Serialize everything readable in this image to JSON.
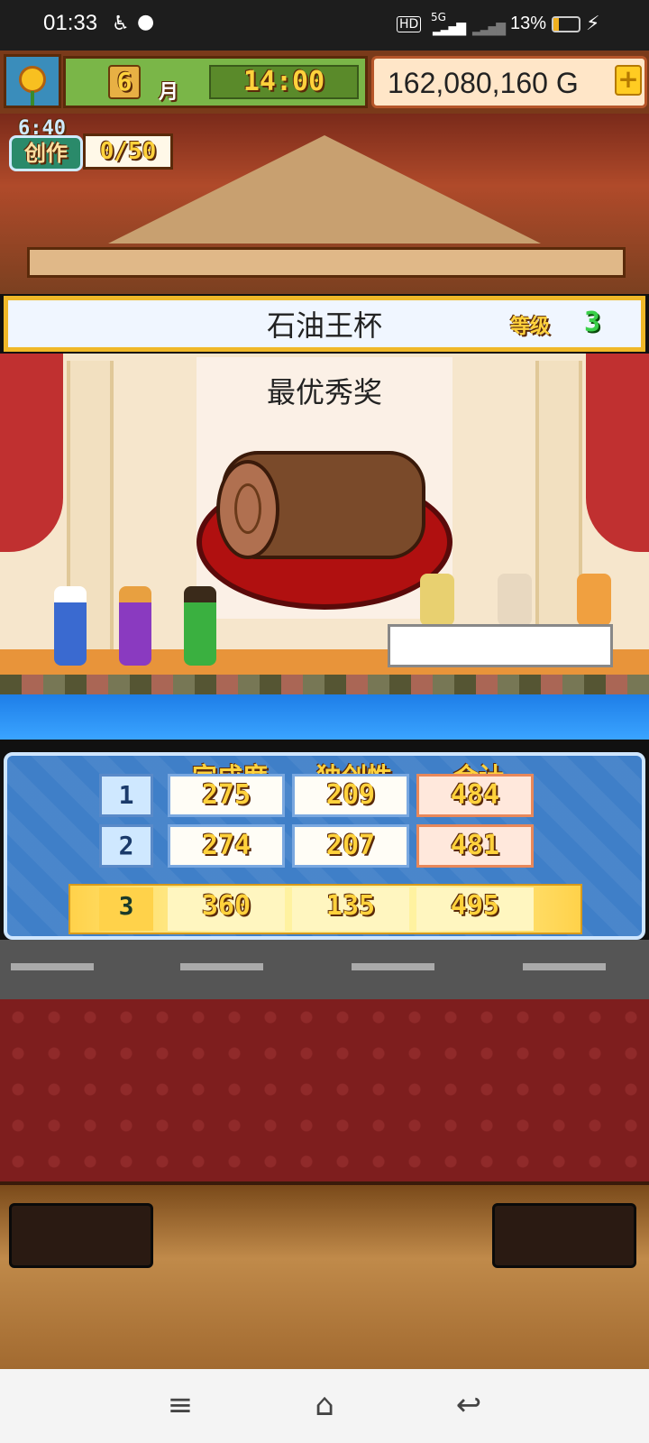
{
  "status_bar": {
    "time": "01:33",
    "network": "5G",
    "battery_percent": "13%"
  },
  "hud": {
    "month_number": "6",
    "month_label": "月",
    "clock": "14:00",
    "money": "162,080,160 G",
    "add_money_label": "+"
  },
  "create": {
    "timer": "6:40",
    "label": "创作",
    "count": "0/50"
  },
  "contest": {
    "title": "石油王杯",
    "rank_label": "等级",
    "rank_value": "3"
  },
  "award": {
    "title": "最优秀奖"
  },
  "scores": {
    "headers": [
      "完成度",
      "独创性",
      "合计"
    ],
    "rows": [
      {
        "rank": "1",
        "completion": "275",
        "originality": "209",
        "total": "484"
      },
      {
        "rank": "2",
        "completion": "274",
        "originality": "207",
        "total": "481"
      },
      {
        "rank": "3",
        "completion": "360",
        "originality": "135",
        "total": "495"
      }
    ]
  },
  "nav": {
    "menu_icon": "menu-icon",
    "home_icon": "home-icon",
    "back_icon": "back-icon"
  }
}
